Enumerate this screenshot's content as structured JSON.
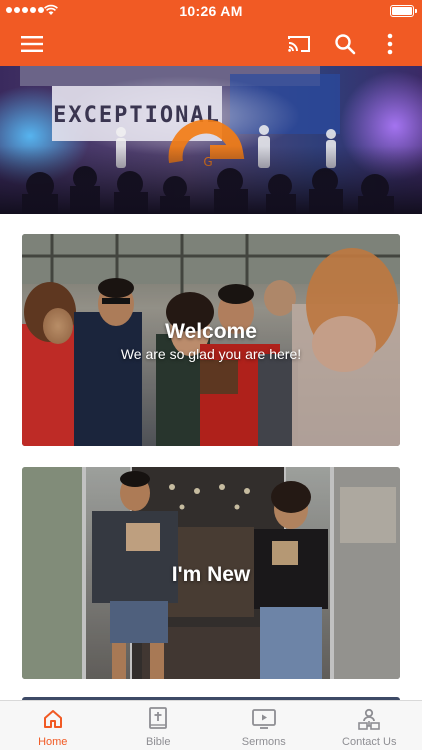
{
  "status_bar": {
    "time": "10:26 AM"
  },
  "app_bar": {
    "accent_color": "#f15a24",
    "icons": [
      "menu-icon",
      "cast-icon",
      "search-icon",
      "more-vertical-icon"
    ]
  },
  "hero": {
    "sign_text": "EXCEPTIONAL",
    "logo_letter": "G"
  },
  "cards": [
    {
      "title": "Welcome",
      "subtitle": "We are so glad you are here!"
    },
    {
      "title": "I'm New",
      "subtitle": ""
    }
  ],
  "tabs": [
    {
      "label": "Home",
      "icon": "home-icon",
      "active": true
    },
    {
      "label": "Bible",
      "icon": "bible-icon",
      "active": false
    },
    {
      "label": "Sermons",
      "icon": "video-play-icon",
      "active": false
    },
    {
      "label": "Contact Us",
      "icon": "contact-icon",
      "active": false
    }
  ]
}
